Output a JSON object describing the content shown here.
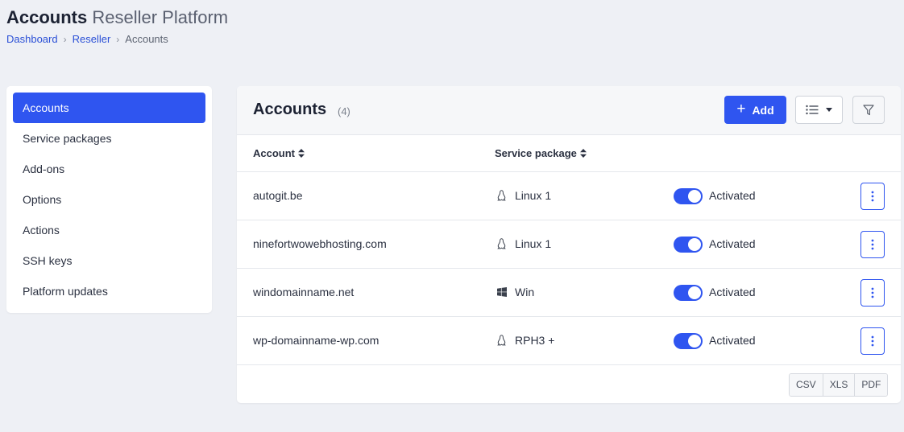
{
  "header": {
    "title_strong": "Accounts",
    "title_light": "Reseller Platform",
    "breadcrumb": {
      "dashboard": "Dashboard",
      "reseller": "Reseller",
      "current": "Accounts",
      "separator": "›"
    }
  },
  "sidebar": {
    "items": [
      {
        "label": "Accounts",
        "active": true
      },
      {
        "label": "Service packages"
      },
      {
        "label": "Add-ons"
      },
      {
        "label": "Options"
      },
      {
        "label": "Actions"
      },
      {
        "label": "SSH keys"
      },
      {
        "label": "Platform updates"
      }
    ]
  },
  "panel": {
    "title": "Accounts",
    "count": "(4)",
    "add_label": "Add",
    "add_icon": "plus-icon",
    "view_icon": "list-icon",
    "filter_icon": "filter-icon"
  },
  "table": {
    "columns": {
      "account": "Account",
      "package": "Service package"
    },
    "rows": [
      {
        "account": "autogit.be",
        "os": "linux",
        "package": "Linux 1",
        "status": "Activated",
        "enabled": true
      },
      {
        "account": "ninefortwowebhosting.com",
        "os": "linux",
        "package": "Linux 1",
        "status": "Activated",
        "enabled": true
      },
      {
        "account": "windomainname.net",
        "os": "windows",
        "package": "Win",
        "status": "Activated",
        "enabled": true
      },
      {
        "account": "wp-domainname-wp.com",
        "os": "linux",
        "package": "RPH3 +",
        "status": "Activated",
        "enabled": true
      }
    ]
  },
  "export": {
    "csv": "CSV",
    "xls": "XLS",
    "pdf": "PDF"
  },
  "colors": {
    "accent": "#2f55f0",
    "background": "#eef0f5",
    "link": "#2a4fd6"
  }
}
